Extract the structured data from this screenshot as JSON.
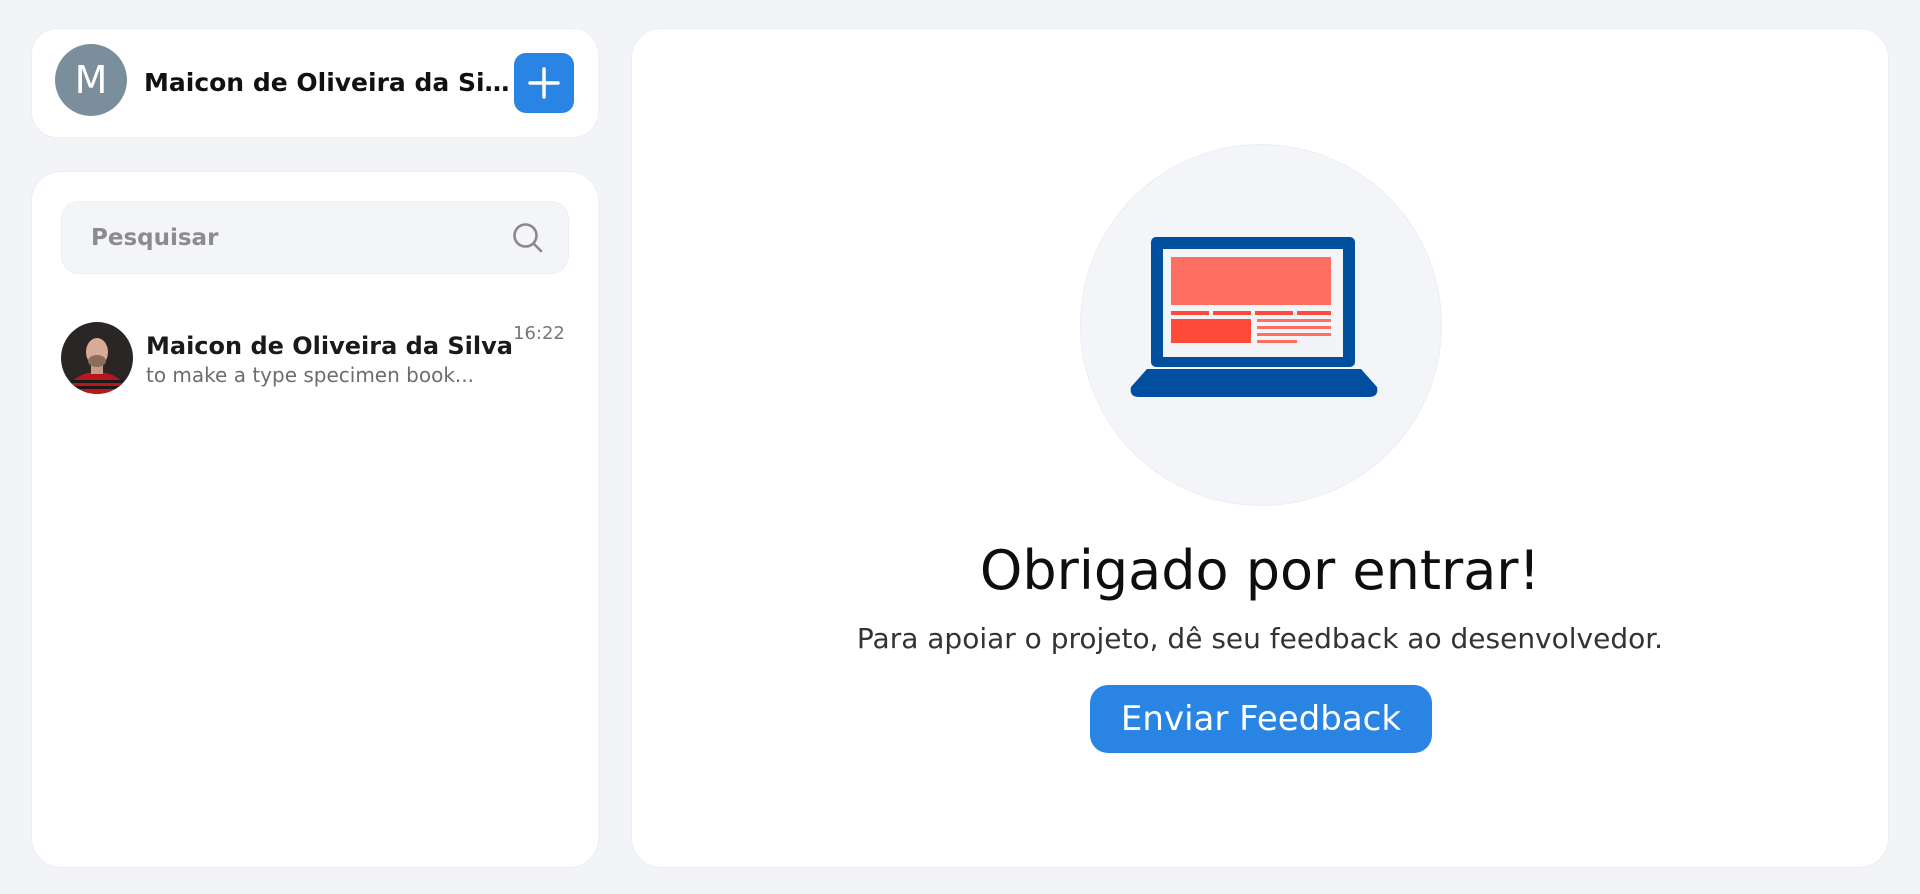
{
  "header": {
    "avatar_letter": "M",
    "user_name": "Maicon de Oliveira da Silva",
    "add_icon": "plus-icon"
  },
  "search": {
    "placeholder": "Pesquisar",
    "value": "",
    "icon": "search-icon"
  },
  "chats": [
    {
      "name": "Maicon de Oliveira da Silva",
      "preview": "to make a type specimen book...",
      "time": "16:22",
      "avatar": "user-photo"
    }
  ],
  "main": {
    "illustration": "laptop-icon",
    "title": "Obrigado por entrar!",
    "subtitle": "Para apoiar o projeto, dê seu feedback ao desenvolvedor.",
    "feedback_button_label": "Enviar Feedback"
  },
  "colors": {
    "accent": "#2a84e4",
    "background": "#f3f4f8",
    "laptop_frame": "#004e9e",
    "laptop_screen_block": "#ff6f61",
    "laptop_screen_block_dark": "#ff4b3a"
  }
}
